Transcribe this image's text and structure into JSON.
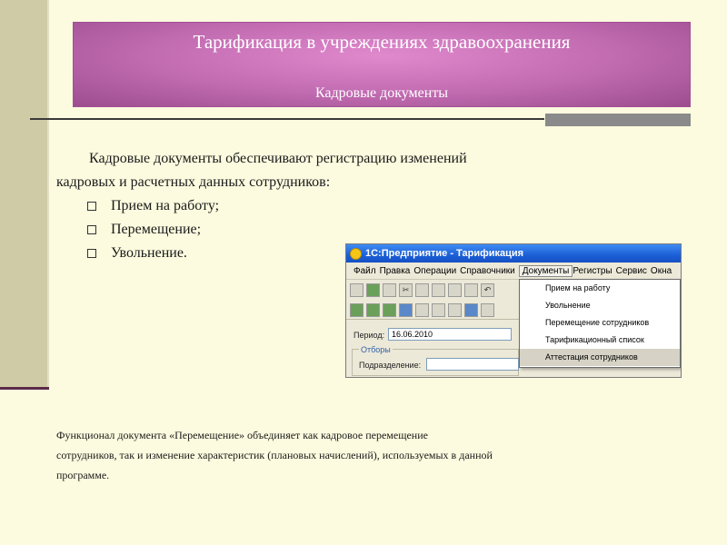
{
  "header": {
    "title": "Тарификация в учреждениях здравоохранения",
    "subtitle": "Кадровые документы"
  },
  "intro": {
    "line1": "Кадровые документы обеспечивают регистрацию изменений",
    "line2": "кадровых и расчетных данных сотрудников:"
  },
  "bullets": [
    "Прием на работу;",
    "Перемещение;",
    "Увольнение."
  ],
  "footer": {
    "line1": "Функционал документа «Перемещение» объединяет как кадровое перемещение",
    "line2": "сотрудников, так и изменение характеристик (плановых начислений), используемых в данной",
    "line3": "программе."
  },
  "app": {
    "title": "1С:Предприятие - Тарификация",
    "menu": [
      "Файл",
      "Правка",
      "Операции",
      "Справочники",
      "Документы",
      "Регистры",
      "Сервис",
      "Окна"
    ],
    "active_menu": "Документы",
    "period_label": "Период:",
    "period_value": "16.06.2010",
    "filters_group": "Отборы",
    "department_label": "Подразделение:",
    "dropdown_items": [
      "Прием на работу",
      "Увольнение",
      "Перемещение сотрудников",
      "Тарификационный список",
      "Аттестация сотрудников"
    ],
    "highlighted_item": "Аттестация сотрудников"
  },
  "colors": {
    "background": "#fcfbdf",
    "banner": "#c06ab0",
    "sidebar": "#cfcba6"
  }
}
